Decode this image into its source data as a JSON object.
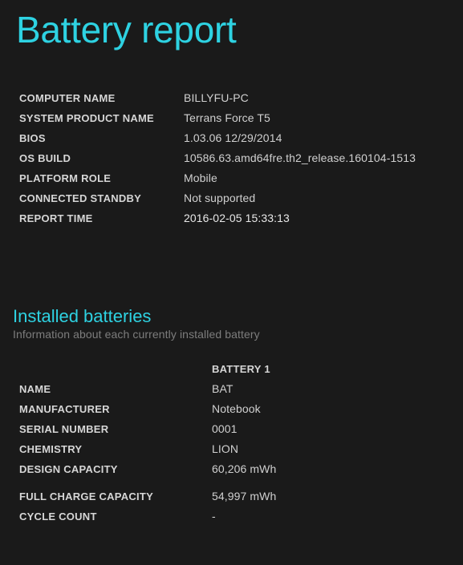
{
  "report": {
    "title": "Battery report"
  },
  "system_info": {
    "rows": [
      {
        "label": "COMPUTER NAME",
        "value": "BILLYFU-PC"
      },
      {
        "label": "SYSTEM PRODUCT NAME",
        "value": "Terrans Force T5"
      },
      {
        "label": "BIOS",
        "value": "1.03.06 12/29/2014"
      },
      {
        "label": "OS BUILD",
        "value": "10586.63.amd64fre.th2_release.160104-1513"
      },
      {
        "label": "PLATFORM ROLE",
        "value": "Mobile"
      },
      {
        "label": "CONNECTED STANDBY",
        "value": "Not supported"
      },
      {
        "label": "REPORT TIME",
        "value": "2016-02-05  15:33:13"
      }
    ]
  },
  "installed_batteries": {
    "heading": "Installed batteries",
    "subheading": "Information about each currently installed battery",
    "column_header": "BATTERY 1",
    "rows": [
      {
        "label": "NAME",
        "value": "BAT"
      },
      {
        "label": "MANUFACTURER",
        "value": "Notebook"
      },
      {
        "label": "SERIAL NUMBER",
        "value": "0001"
      },
      {
        "label": "CHEMISTRY",
        "value": "LION"
      },
      {
        "label": "DESIGN CAPACITY",
        "value": "60,206 mWh"
      },
      {
        "label": "FULL CHARGE CAPACITY",
        "value": "54,997 mWh"
      },
      {
        "label": "CYCLE COUNT",
        "value": "-"
      }
    ]
  },
  "colors": {
    "background": "#1a1a1a",
    "accent": "#2ed2e2",
    "label": "#d6d6d6",
    "value": "#d0d0d0",
    "subtitle": "#7d7d7d"
  }
}
